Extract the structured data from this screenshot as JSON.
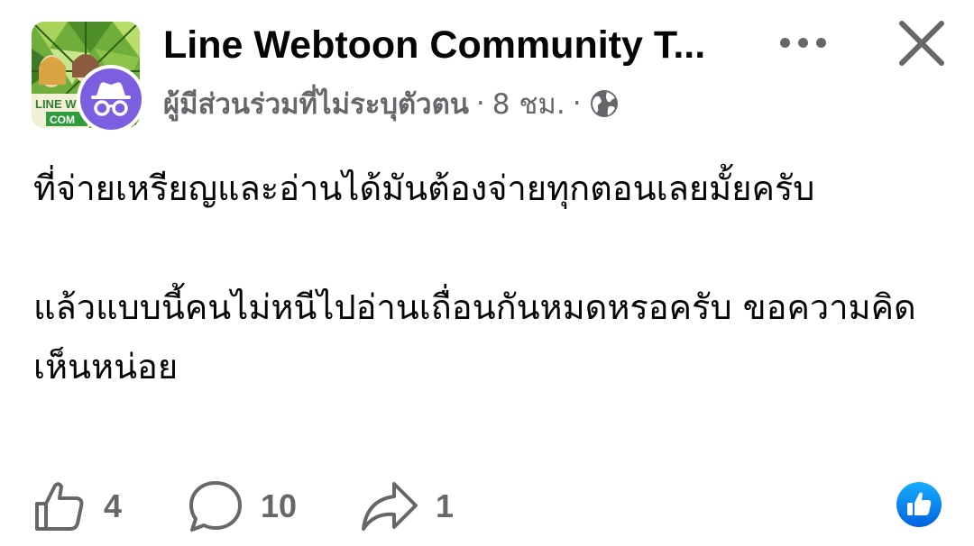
{
  "header": {
    "group_name": "Line Webtoon Community T...",
    "author": "ผู้มีส่วนร่วมที่ไม่ระบุตัวตน",
    "separator": "·",
    "time": "8 ชม.",
    "privacy_icon": "globe-icon",
    "group_avatar_text": [
      "LINE W",
      "COM"
    ]
  },
  "post": {
    "paragraphs": [
      "ที่จ่ายเหรียญและอ่านได้มันต้องจ่ายทุกตอนเลยมั้ยครับ",
      "แล้วแบบนี้คนไม่หนีไปอ่านเถื่อนกันหมดหรอครับ ขอความคิดเห็นหน่อย"
    ]
  },
  "actions": {
    "likes": "4",
    "comments": "10",
    "shares": "1"
  },
  "colors": {
    "text": "#050505",
    "secondary": "#65676b",
    "anonymous_badge": "#7b5fe0",
    "like_blue": "#1877f2"
  }
}
